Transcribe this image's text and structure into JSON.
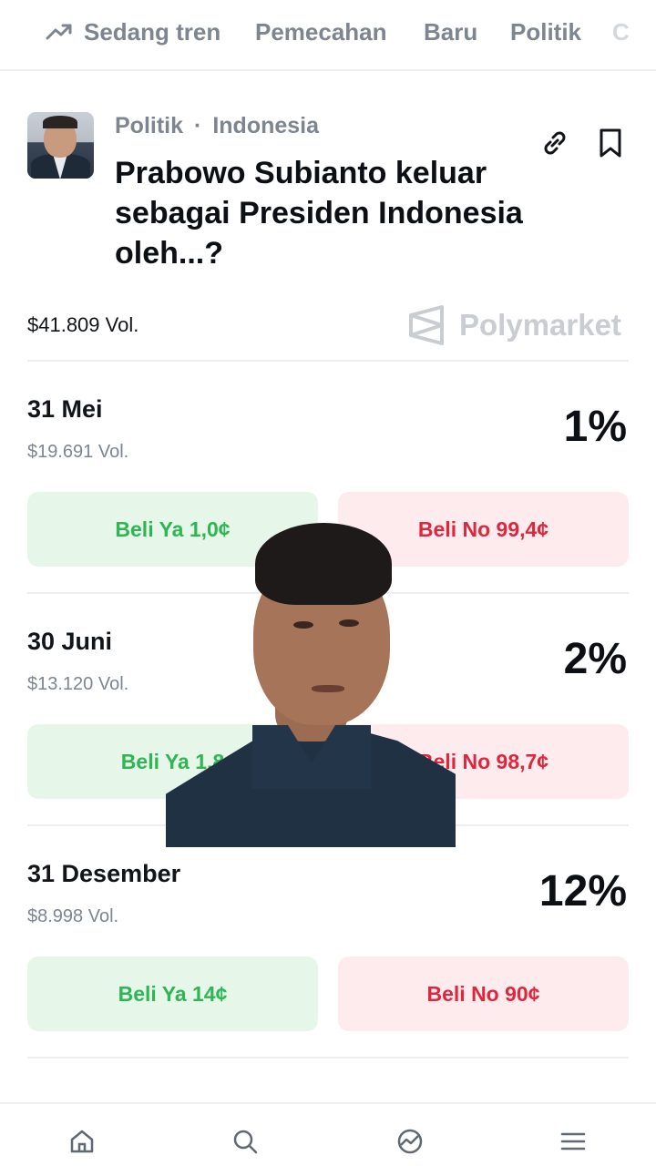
{
  "tabs": [
    {
      "label": "Sedang tren",
      "icon": "trending-up-icon"
    },
    {
      "label": "Pemecahan"
    },
    {
      "label": "Baru"
    },
    {
      "label": "Politik"
    },
    {
      "label": "C"
    }
  ],
  "market": {
    "category": "Politik",
    "subcategory": "Indonesia",
    "separator": "·",
    "title": "Prabowo Subianto keluar sebagai Presiden Indonesia oleh...?",
    "volume": "$41.809 Vol.",
    "brand": "Polymarket"
  },
  "outcomes": [
    {
      "date": "31 Mei",
      "volume": "$19.691 Vol.",
      "percent": "1%",
      "yes_label": "Beli Ya 1,0¢",
      "no_label": "Beli No 99,4¢"
    },
    {
      "date": "30 Juni",
      "volume": "$13.120 Vol.",
      "percent": "2%",
      "yes_label": "Beli Ya 1,8",
      "no_label": "Beli No 98,7¢"
    },
    {
      "date": "31 Desember",
      "volume": "$8.998 Vol.",
      "percent": "12%",
      "yes_label": "Beli Ya 14¢",
      "no_label": "Beli No 90¢"
    }
  ],
  "colors": {
    "yes_bg": "#e6f7ea",
    "yes_text": "#2fb553",
    "no_bg": "#fdebee",
    "no_text": "#e0263c"
  },
  "bottom_nav": [
    {
      "icon": "home-icon"
    },
    {
      "icon": "search-icon"
    },
    {
      "icon": "activity-icon"
    },
    {
      "icon": "menu-icon"
    }
  ]
}
